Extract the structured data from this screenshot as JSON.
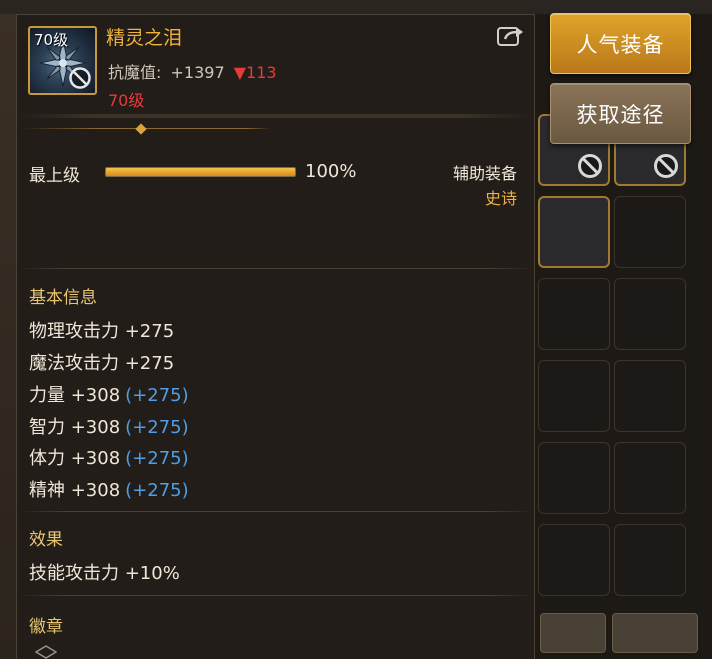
{
  "tooltip": {
    "item_level_badge": "70级",
    "item_name": "精灵之泪",
    "resist_label": "抗魔值:",
    "resist_value": "+1397",
    "resist_change": "▼113",
    "level_requirement": "70级",
    "grade_label": "最上级",
    "grade_percent": "100%",
    "grade_fill_fraction": 1.0,
    "equip_type": "辅助装备",
    "equip_rarity": "史诗",
    "basic_info_title": "基本信息",
    "stats": [
      {
        "text": "物理攻击力 +275",
        "bonus": ""
      },
      {
        "text": "魔法攻击力 +275",
        "bonus": ""
      },
      {
        "text": "力量 +308",
        "bonus": "(+275)"
      },
      {
        "text": "智力 +308",
        "bonus": "(+275)"
      },
      {
        "text": "体力 +308",
        "bonus": "(+275)"
      },
      {
        "text": "精神 +308",
        "bonus": "(+275)"
      }
    ],
    "effect_title": "效果",
    "effect_text": "技能攻击力 +10%",
    "emblem_title": "徽章"
  },
  "side_buttons": {
    "popular_label": "人气装备",
    "source_label": "获取途径"
  },
  "colors": {
    "item_name": "#f0b23a",
    "level_red": "#e83a3a",
    "bonus_blue": "#4f9ee6",
    "section_gold": "#e8c670",
    "button_gold": "#d49a26"
  },
  "icons": [
    "ban-icon",
    "share-icon",
    "emblem-icon"
  ]
}
